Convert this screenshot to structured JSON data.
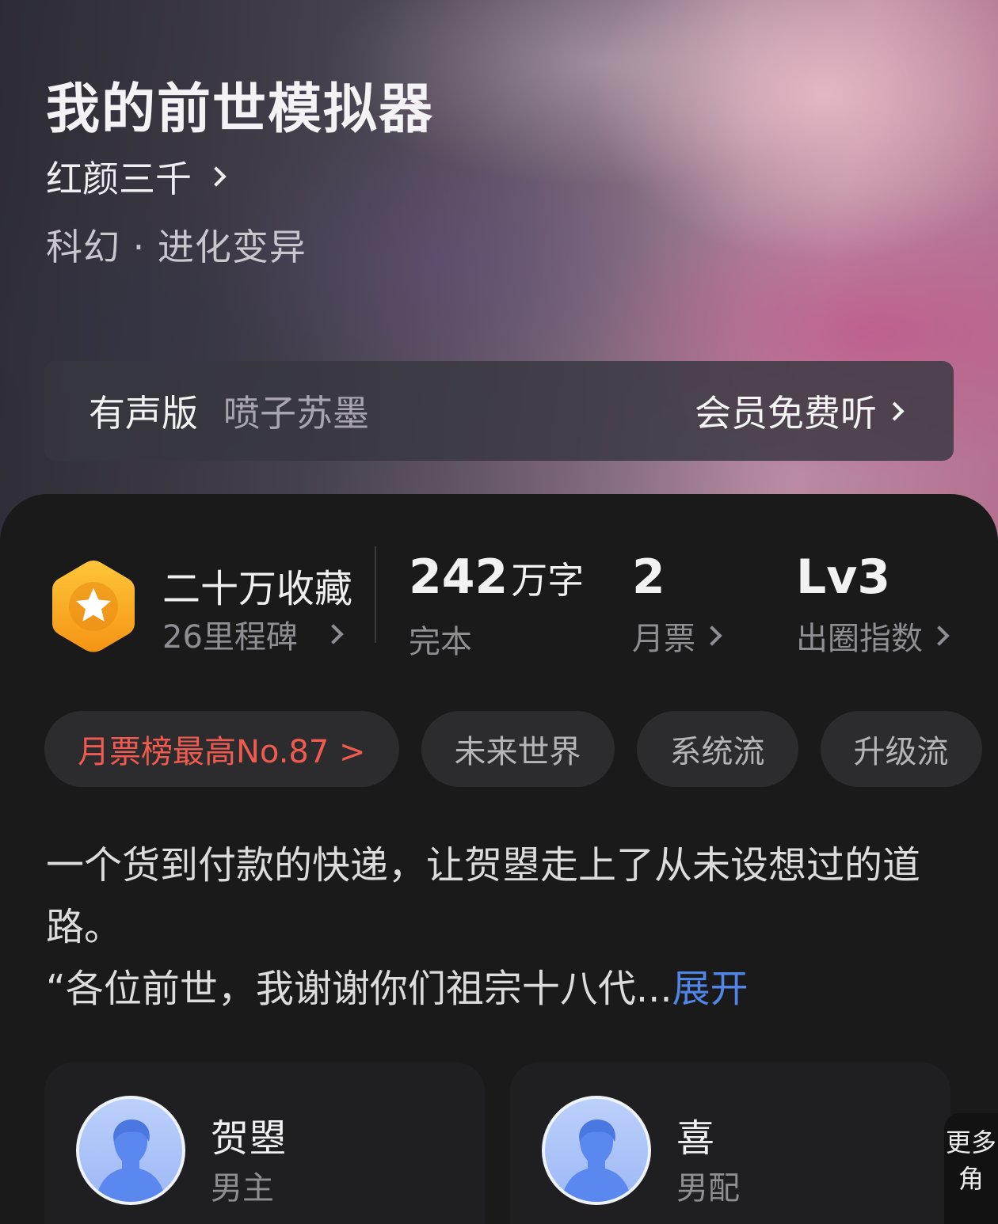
{
  "book": {
    "title": "我的前世模拟器",
    "author": "红颜三千",
    "genre": "科幻 · 进化变异"
  },
  "audio": {
    "label": "有声版",
    "narrator": "喷子苏墨",
    "cta": "会员免费听"
  },
  "stats": {
    "favorites": {
      "title": "二十万收藏",
      "milestone": "26里程碑"
    },
    "words": {
      "value": "242",
      "unit": "万字",
      "status": "完本"
    },
    "monthly_ticket": {
      "value": "2",
      "label": "月票"
    },
    "index": {
      "value": "Lv3",
      "label": "出圈指数"
    }
  },
  "tags": [
    {
      "label": "月票榜最高No.87 >",
      "type": "rank"
    },
    {
      "label": "未来世界",
      "type": "tag"
    },
    {
      "label": "系统流",
      "type": "tag"
    },
    {
      "label": "升级流",
      "type": "tag"
    }
  ],
  "synopsis": {
    "text": "一个货到付款的快递，让贺曌走上了从未设想过的道路。\n“各位前世，我谢谢你们祖宗十八代...",
    "expand": "展开"
  },
  "characters": [
    {
      "name": "贺曌",
      "role": "男主"
    },
    {
      "name": "喜",
      "role": "男配"
    }
  ],
  "more_characters": "更多角",
  "colors": {
    "accent_link": "#4f86e8",
    "rank_tag": "#f05a4f",
    "badge_gold": "#f8a51d"
  }
}
